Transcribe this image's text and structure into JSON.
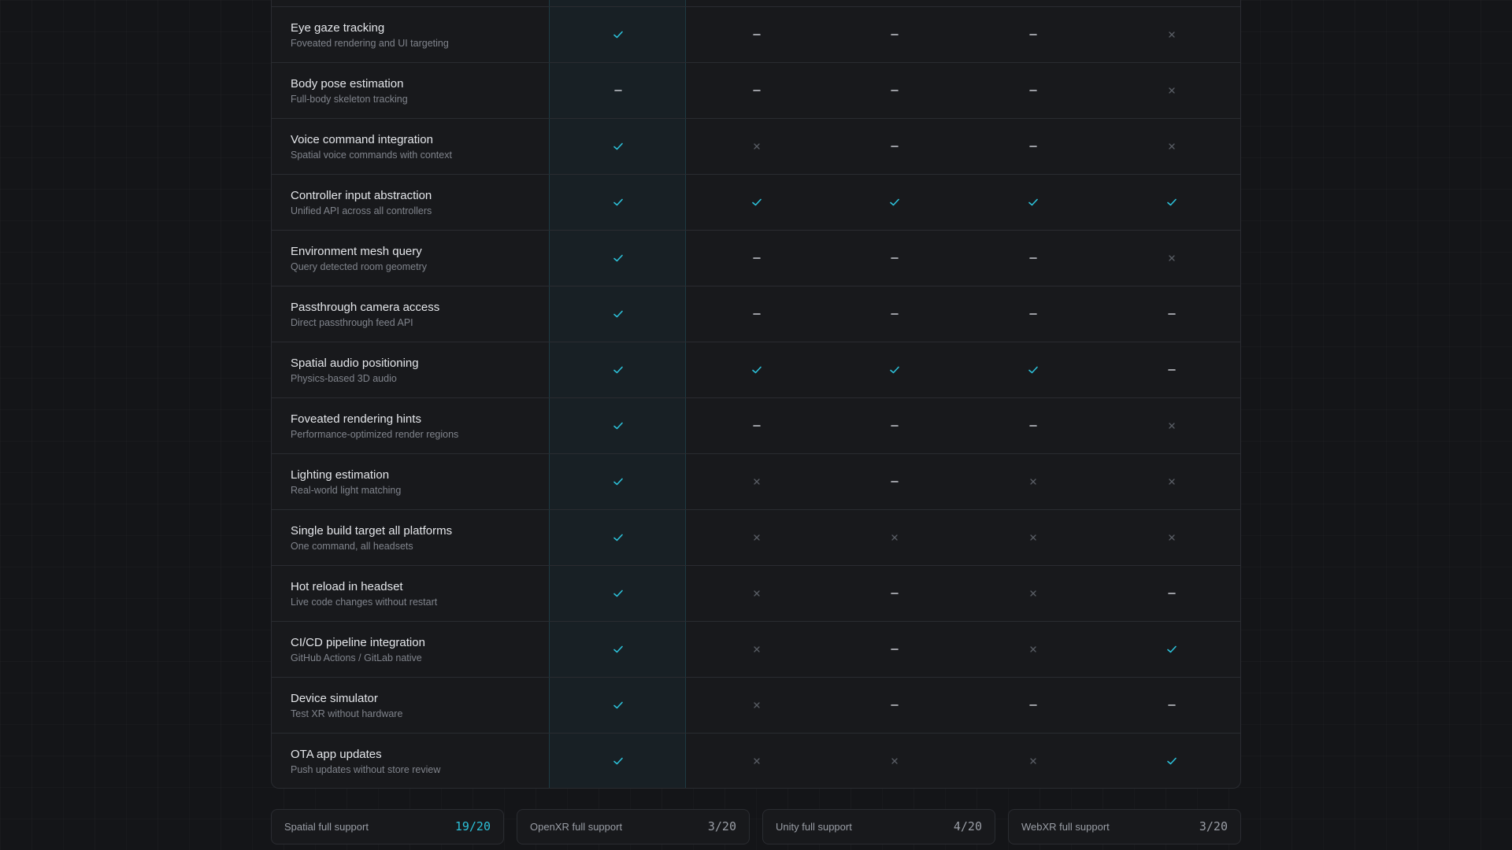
{
  "colors": {
    "accent": "#2cc0d8",
    "dash": "#c8cbd1",
    "cross": "#5a5e66",
    "background": "#141518"
  },
  "legend": {
    "full": "check-icon",
    "partial": "dash-icon",
    "none": "cross-icon"
  },
  "features": [
    {
      "name": "Eye gaze tracking",
      "desc": "Foveated rendering and UI targeting",
      "support": [
        "full",
        "partial",
        "partial",
        "partial",
        "none"
      ]
    },
    {
      "name": "Body pose estimation",
      "desc": "Full-body skeleton tracking",
      "support": [
        "partial",
        "partial",
        "partial",
        "partial",
        "none"
      ]
    },
    {
      "name": "Voice command integration",
      "desc": "Spatial voice commands with context",
      "support": [
        "full",
        "none",
        "partial",
        "partial",
        "none"
      ]
    },
    {
      "name": "Controller input abstraction",
      "desc": "Unified API across all controllers",
      "support": [
        "full",
        "full",
        "full",
        "full",
        "full"
      ]
    },
    {
      "name": "Environment mesh query",
      "desc": "Query detected room geometry",
      "support": [
        "full",
        "partial",
        "partial",
        "partial",
        "none"
      ]
    },
    {
      "name": "Passthrough camera access",
      "desc": "Direct passthrough feed API",
      "support": [
        "full",
        "partial",
        "partial",
        "partial",
        "partial"
      ]
    },
    {
      "name": "Spatial audio positioning",
      "desc": "Physics-based 3D audio",
      "support": [
        "full",
        "full",
        "full",
        "full",
        "partial"
      ]
    },
    {
      "name": "Foveated rendering hints",
      "desc": "Performance-optimized render regions",
      "support": [
        "full",
        "partial",
        "partial",
        "partial",
        "none"
      ]
    },
    {
      "name": "Lighting estimation",
      "desc": "Real-world light matching",
      "support": [
        "full",
        "none",
        "partial",
        "none",
        "none"
      ]
    },
    {
      "name": "Single build target all platforms",
      "desc": "One command, all headsets",
      "support": [
        "full",
        "none",
        "none",
        "none",
        "none"
      ]
    },
    {
      "name": "Hot reload in headset",
      "desc": "Live code changes without restart",
      "support": [
        "full",
        "none",
        "partial",
        "none",
        "partial"
      ]
    },
    {
      "name": "CI/CD pipeline integration",
      "desc": "GitHub Actions / GitLab native",
      "support": [
        "full",
        "none",
        "partial",
        "none",
        "full"
      ]
    },
    {
      "name": "Device simulator",
      "desc": "Test XR without hardware",
      "support": [
        "full",
        "none",
        "partial",
        "partial",
        "partial"
      ]
    },
    {
      "name": "OTA app updates",
      "desc": "Push updates without store review",
      "support": [
        "full",
        "none",
        "none",
        "none",
        "full"
      ]
    }
  ],
  "summary": [
    {
      "label": "Spatial full support",
      "value": "19/20",
      "accent": true
    },
    {
      "label": "OpenXR full support",
      "value": "3/20",
      "accent": false
    },
    {
      "label": "Unity full support",
      "value": "4/20",
      "accent": false
    },
    {
      "label": "WebXR full support",
      "value": "3/20",
      "accent": false
    }
  ]
}
